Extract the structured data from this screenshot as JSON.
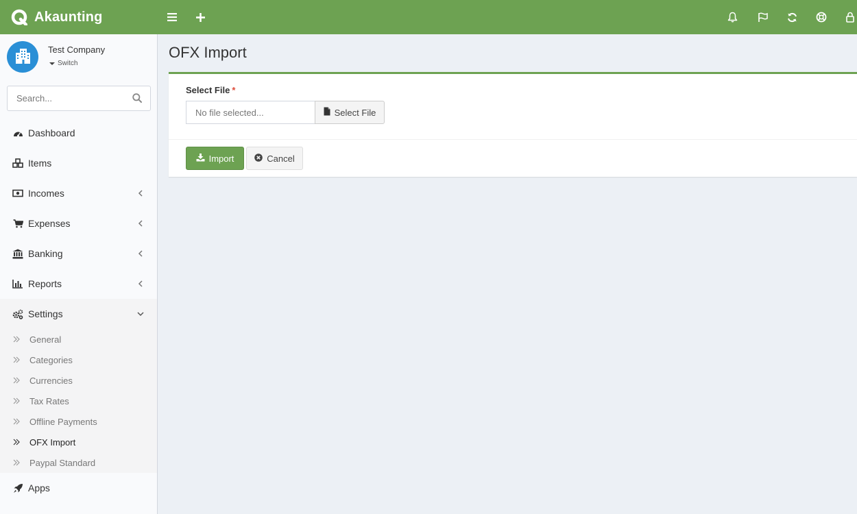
{
  "app": {
    "name": "Akaunting",
    "brand_color": "#6da252"
  },
  "header": {
    "icons": [
      "menu-icon",
      "plus-icon",
      "bell-icon",
      "flag-icon",
      "refresh-icon",
      "life-ring-icon",
      "user-icon"
    ]
  },
  "company": {
    "name": "Test Company",
    "switch_label": "Switch"
  },
  "search": {
    "placeholder": "Search..."
  },
  "sidebar": {
    "items": [
      {
        "label": "Dashboard",
        "icon": "dashboard-icon",
        "has_children": false
      },
      {
        "label": "Items",
        "icon": "cubes-icon",
        "has_children": false
      },
      {
        "label": "Incomes",
        "icon": "money-icon",
        "has_children": true
      },
      {
        "label": "Expenses",
        "icon": "cart-icon",
        "has_children": true
      },
      {
        "label": "Banking",
        "icon": "bank-icon",
        "has_children": true
      },
      {
        "label": "Reports",
        "icon": "bar-chart-icon",
        "has_children": true
      },
      {
        "label": "Settings",
        "icon": "gears-icon",
        "has_children": true,
        "expanded": true
      }
    ],
    "settings_sub": [
      {
        "label": "General"
      },
      {
        "label": "Categories"
      },
      {
        "label": "Currencies"
      },
      {
        "label": "Tax Rates"
      },
      {
        "label": "Offline Payments"
      },
      {
        "label": "OFX Import",
        "current": true
      },
      {
        "label": "Paypal Standard"
      }
    ],
    "apps": {
      "label": "Apps",
      "icon": "rocket-icon"
    }
  },
  "main": {
    "title": "OFX Import",
    "form": {
      "file_label": "Select File",
      "required_mark": "*",
      "file_placeholder": "No file selected...",
      "select_button": "Select File",
      "import_button": "Import",
      "cancel_button": "Cancel"
    }
  }
}
